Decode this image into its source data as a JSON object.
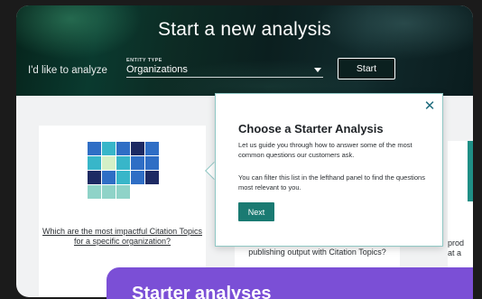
{
  "hero": {
    "title": "Start a new analysis",
    "analyze_label": "I'd like to analyze",
    "entity_caption": "ENTITY TYPE",
    "entity_value": "Organizations",
    "start_label": "Start"
  },
  "cards": [
    {
      "link": "Which are the most impactful Citation Topics for a specific organization?",
      "icon": "grid-icon"
    },
    {
      "text": "publishing output with Citation Topics?"
    },
    {
      "text": "prod at a"
    }
  ],
  "popover": {
    "close_icon": "close-icon",
    "title": "Choose a Starter Analysis",
    "body_1": "Let us guide you through how to answer some of the most common questions our customers ask.",
    "body_2": "You can filter this list in the lefthand panel to find the questions most relevant to you.",
    "next_label": "Next"
  },
  "banner": {
    "text": "Starter analyses"
  },
  "colors": {
    "accent_teal": "#1a7a72",
    "banner_purple": "#7b4fd6",
    "navy": "#1d2a63",
    "blue": "#2f6ec5",
    "light_teal": "#8fd3c8",
    "pale_green": "#d4f0c7"
  }
}
